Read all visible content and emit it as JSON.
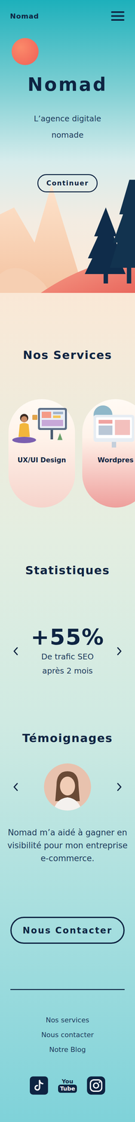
{
  "header": {
    "logo": "Nomad"
  },
  "hero": {
    "title": "Nomad",
    "subtitle": "L’agence digitale nomade",
    "button": "Continuer"
  },
  "services": {
    "title": "Nos Services",
    "cards": [
      {
        "label": "UX/UI Design",
        "kind": "uxui",
        "color": "#f6d3cb"
      },
      {
        "label": "Wordpres",
        "kind": "wordpress",
        "color": "#ee9f9c"
      }
    ]
  },
  "stats": {
    "title": "Statistiques",
    "value": "+55%",
    "caption": "De trafic SEO après 2 mois"
  },
  "testimonials": {
    "title": "Témoignages",
    "quote": "Nomad m’a aidé à gagner en visibilité pour mon entreprise e-commerce."
  },
  "contact": {
    "button": "Nous Contacter"
  },
  "footer": {
    "links": [
      "Nos services",
      "Nous contacter",
      "Notre Blog"
    ],
    "socials": [
      {
        "kind": "tiktok"
      },
      {
        "kind": "youtube",
        "text": [
          "You",
          "Tube"
        ]
      },
      {
        "kind": "instagram"
      }
    ]
  }
}
